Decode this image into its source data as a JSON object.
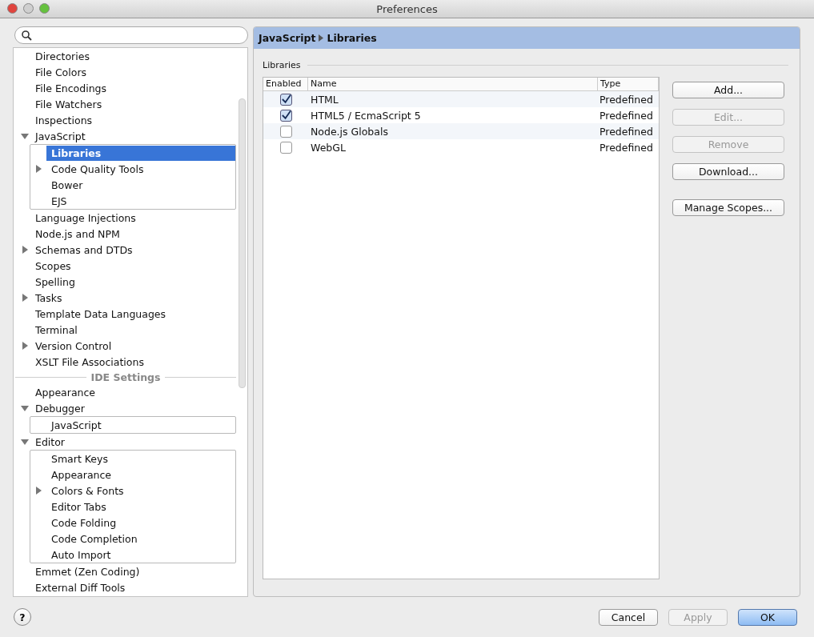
{
  "window": {
    "title": "Preferences"
  },
  "sidebar": {
    "sections": [
      {
        "items": [
          {
            "label": "Directories",
            "selected": false
          },
          {
            "label": "File Colors",
            "selected": false
          },
          {
            "label": "File Encodings",
            "selected": false
          },
          {
            "label": "File Watchers",
            "selected": false
          },
          {
            "label": "Inspections",
            "selected": false
          },
          {
            "label": "JavaScript",
            "selected": false,
            "expanded": true,
            "children": [
              {
                "label": "Libraries",
                "selected": true
              },
              {
                "label": "Code Quality Tools",
                "selected": false,
                "expanded": false
              },
              {
                "label": "Bower",
                "selected": false
              },
              {
                "label": "EJS",
                "selected": false
              }
            ]
          },
          {
            "label": "Language Injections",
            "selected": false
          },
          {
            "label": "Node.js and NPM",
            "selected": false
          },
          {
            "label": "Schemas and DTDs",
            "selected": false,
            "expanded": false
          },
          {
            "label": "Scopes",
            "selected": false
          },
          {
            "label": "Spelling",
            "selected": false
          },
          {
            "label": "Tasks",
            "selected": false,
            "expanded": false
          },
          {
            "label": "Template Data Languages",
            "selected": false
          },
          {
            "label": "Terminal",
            "selected": false
          },
          {
            "label": "Version Control",
            "selected": false,
            "expanded": false
          },
          {
            "label": "XSLT File Associations",
            "selected": false
          }
        ]
      },
      {
        "heading": "IDE Settings",
        "items": [
          {
            "label": "Appearance",
            "selected": false
          },
          {
            "label": "Debugger",
            "selected": false,
            "expanded": true,
            "children": [
              {
                "label": "JavaScript",
                "selected": false
              }
            ]
          },
          {
            "label": "Editor",
            "selected": false,
            "expanded": true,
            "children": [
              {
                "label": "Smart Keys",
                "selected": false
              },
              {
                "label": "Appearance",
                "selected": false
              },
              {
                "label": "Colors & Fonts",
                "selected": false,
                "expanded": false
              },
              {
                "label": "Editor Tabs",
                "selected": false
              },
              {
                "label": "Code Folding",
                "selected": false
              },
              {
                "label": "Code Completion",
                "selected": false
              },
              {
                "label": "Auto Import",
                "selected": false
              }
            ]
          },
          {
            "label": "Emmet (Zen Coding)",
            "selected": false
          },
          {
            "label": "External Diff Tools",
            "selected": false
          }
        ]
      }
    ]
  },
  "breadcrumb": [
    "JavaScript",
    "Libraries"
  ],
  "libraries": {
    "title": "Libraries",
    "columns": [
      "Enabled",
      "Name",
      "Type"
    ],
    "rows": [
      {
        "enabled": true,
        "name": "HTML",
        "type": "Predefined"
      },
      {
        "enabled": true,
        "name": "HTML5 / EcmaScript 5",
        "type": "Predefined"
      },
      {
        "enabled": false,
        "name": "Node.js Globals",
        "type": "Predefined"
      },
      {
        "enabled": false,
        "name": "WebGL",
        "type": "Predefined"
      }
    ]
  },
  "side_buttons": [
    {
      "label": "Add...",
      "disabled": false
    },
    {
      "label": "Edit...",
      "disabled": true
    },
    {
      "label": "Remove",
      "disabled": true
    },
    {
      "label": "Download...",
      "disabled": false
    },
    {
      "label": "Manage Scopes...",
      "disabled": false
    }
  ],
  "help": {
    "label": "?"
  },
  "buttons": [
    {
      "label": "Cancel",
      "disabled": false,
      "kind": "normal"
    },
    {
      "label": "Apply",
      "disabled": true,
      "kind": "normal"
    },
    {
      "label": "OK",
      "disabled": false,
      "kind": "default"
    }
  ]
}
